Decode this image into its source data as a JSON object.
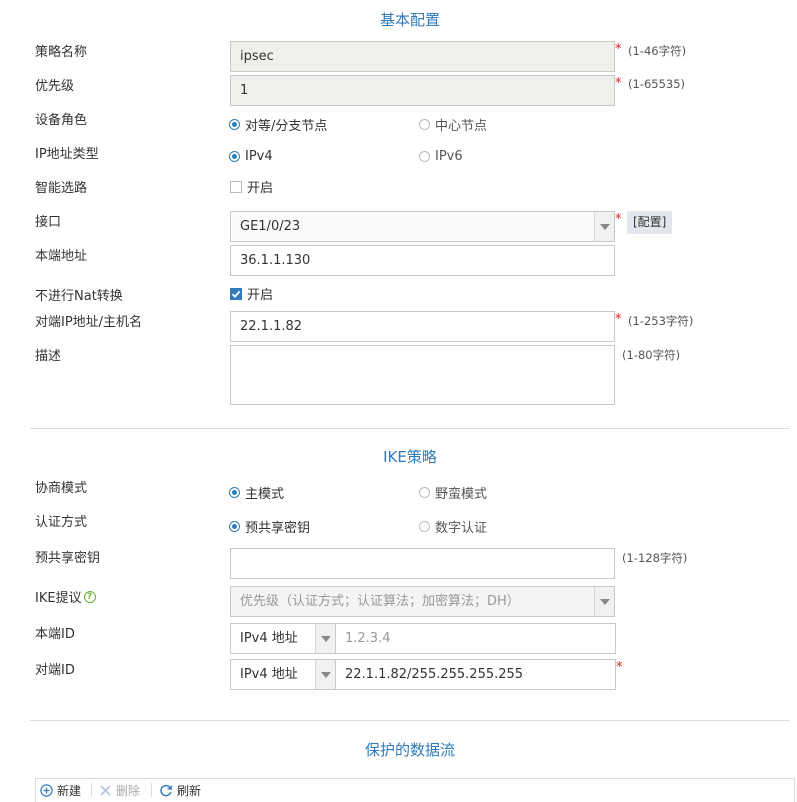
{
  "basic": {
    "title": "基本配置",
    "policy_name": {
      "label": "策略名称",
      "value": "ipsec",
      "hint": "(1-46字符)"
    },
    "priority": {
      "label": "优先级",
      "value": "1",
      "hint": "(1-65535)"
    },
    "device_role": {
      "label": "设备角色",
      "options": [
        "对等/分支节点",
        "中心节点"
      ],
      "selected": "对等/分支节点"
    },
    "ip_type": {
      "label": "IP地址类型",
      "options": [
        "IPv4",
        "IPv6"
      ],
      "selected": "IPv4"
    },
    "smart_route": {
      "label": "智能选路",
      "check_label": "开启",
      "checked": false
    },
    "interface": {
      "label": "接口",
      "value": "GE1/0/23",
      "config_btn": "[配置]"
    },
    "local_addr": {
      "label": "本端地址",
      "value": "36.1.1.130"
    },
    "no_nat": {
      "label": "不进行Nat转换",
      "check_label": "开启",
      "checked": true
    },
    "peer": {
      "label": "对端IP地址/主机名",
      "value": "22.1.1.82",
      "hint": "(1-253字符)"
    },
    "desc": {
      "label": "描述",
      "value": "",
      "hint": "(1-80字符)"
    }
  },
  "ike": {
    "title": "IKE策略",
    "mode": {
      "label": "协商模式",
      "options": [
        "主模式",
        "野蛮模式"
      ],
      "selected": "主模式"
    },
    "auth": {
      "label": "认证方式",
      "options": [
        "预共享密钥",
        "数字认证"
      ],
      "selected": "预共享密钥"
    },
    "psk": {
      "label": "预共享密钥",
      "value": "",
      "hint": "(1-128字符)"
    },
    "proposal": {
      "label": "IKE提议",
      "placeholder": "优先级（认证方式；认证算法；加密算法；DH）"
    },
    "local_id": {
      "label": "本端ID",
      "type": "IPv4 地址",
      "value": "1.2.3.4"
    },
    "peer_id": {
      "label": "对端ID",
      "type": "IPv4 地址",
      "value": "22.1.1.82/255.255.255.255"
    }
  },
  "flow": {
    "title": "保护的数据流",
    "toolbar": {
      "new": "新建",
      "delete": "删除",
      "refresh": "刷新"
    }
  },
  "colors": {
    "accent": "#2f7bbd",
    "required": "#e0201f",
    "help": "#6bb33a"
  }
}
